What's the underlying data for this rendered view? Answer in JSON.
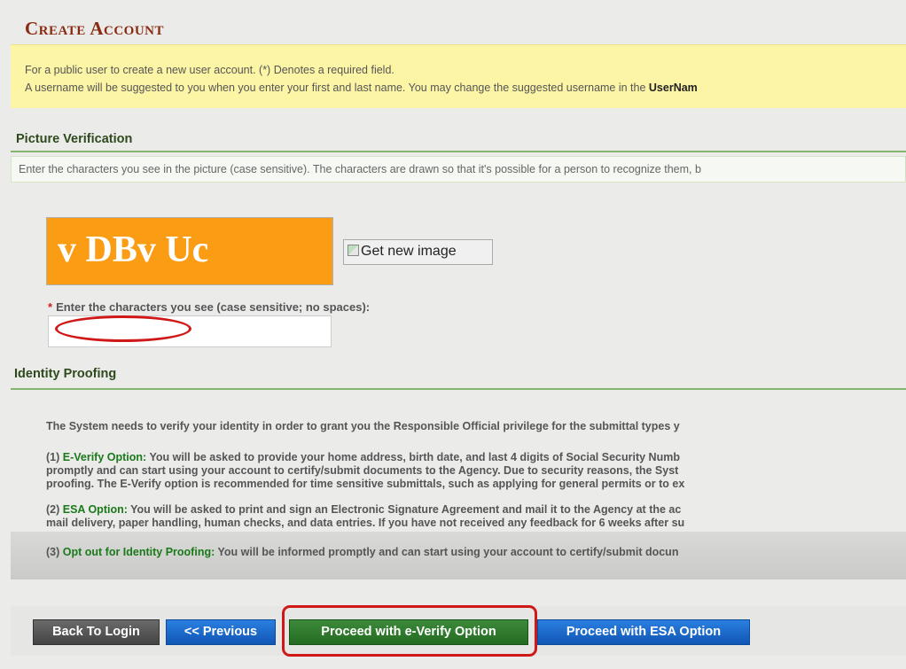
{
  "header": {
    "title": "Create Account"
  },
  "info": {
    "line1": "For a public user to create a new user account. (*) Denotes a required field.",
    "line2": "A username will be suggested to you when you enter your first and last name. You may change the suggested username in the ",
    "line2_bold": "UserNam"
  },
  "picture_verification": {
    "heading": "Picture Verification",
    "instructions": "Enter the characters you see in the picture (case sensitive). The characters are drawn so that it's possible for a person to recognize them, b",
    "captcha_text": "v DBv Uc",
    "new_image_label": "Get new image",
    "required_mark": "*",
    "input_label": "Enter the characters you see (case sensitive; no spaces):",
    "input_value": ""
  },
  "identity_proofing": {
    "heading": "Identity Proofing",
    "intro": "The System needs to verify your identity in order to grant you the Responsible Official privilege for the submittal types y",
    "everify_prefix": "(1) ",
    "everify_title": "E-Verify Option:",
    "everify_line1": " You will be asked to provide your home address, birth date, and last 4 digits of Social Security Numb",
    "everify_line2": "promptly and can start using your account to certify/submit documents to the Agency. Due to security reasons, the Syst",
    "everify_line3": "proofing. The E-Verify option is recommended for time sensitive submittals, such as applying for general permits or to ex",
    "esa_prefix": "(2) ",
    "esa_title": "ESA Option:",
    "esa_line1": " You will be asked to print and sign an Electronic Signature Agreement and mail it to the Agency at the ac",
    "esa_line2": "mail delivery, paper handling, human checks, and data entries. If you have not received any feedback for 6 weeks after su",
    "optout_prefix": "(3) ",
    "optout_title": "Opt out for Identity Proofing:",
    "optout_line": " You will be informed promptly and can start using your account to certify/submit docun"
  },
  "buttons": {
    "back": "Back To Login",
    "previous": "<< Previous",
    "everify": "Proceed with e-Verify Option",
    "esa": "Proceed with ESA Option"
  },
  "colors": {
    "title": "#8a2a10",
    "info_background": "#fdf5a6",
    "captcha_background": "#fa9c14",
    "highlight": "#d01818",
    "option_green": "#1a7a1a"
  }
}
